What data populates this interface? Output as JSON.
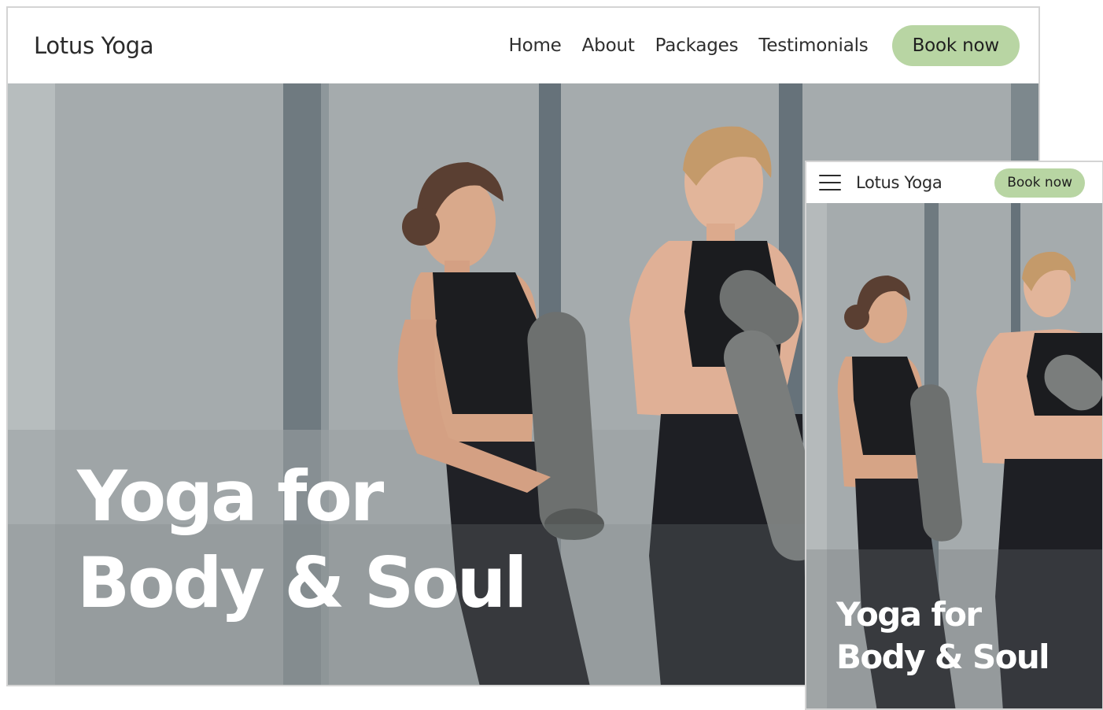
{
  "desktop": {
    "brand": "Lotus Yoga",
    "nav": [
      {
        "label": "Home"
      },
      {
        "label": "About"
      },
      {
        "label": "Packages"
      },
      {
        "label": "Testimonials"
      }
    ],
    "book_label": "Book now",
    "hero": {
      "line1": "Yoga for",
      "line2": "Body & Soul",
      "image_icon": "hero-photo"
    }
  },
  "mobile": {
    "menu_icon": "hamburger-icon",
    "brand": "Lotus Yoga",
    "book_label": "Book now",
    "hero": {
      "line1": "Yoga for",
      "line2": "Body & Soul",
      "image_icon": "hero-photo"
    }
  },
  "colors": {
    "accent": "#b8d5a3",
    "text": "#2b2b2b",
    "hero_bg": "#a3a9ab"
  }
}
